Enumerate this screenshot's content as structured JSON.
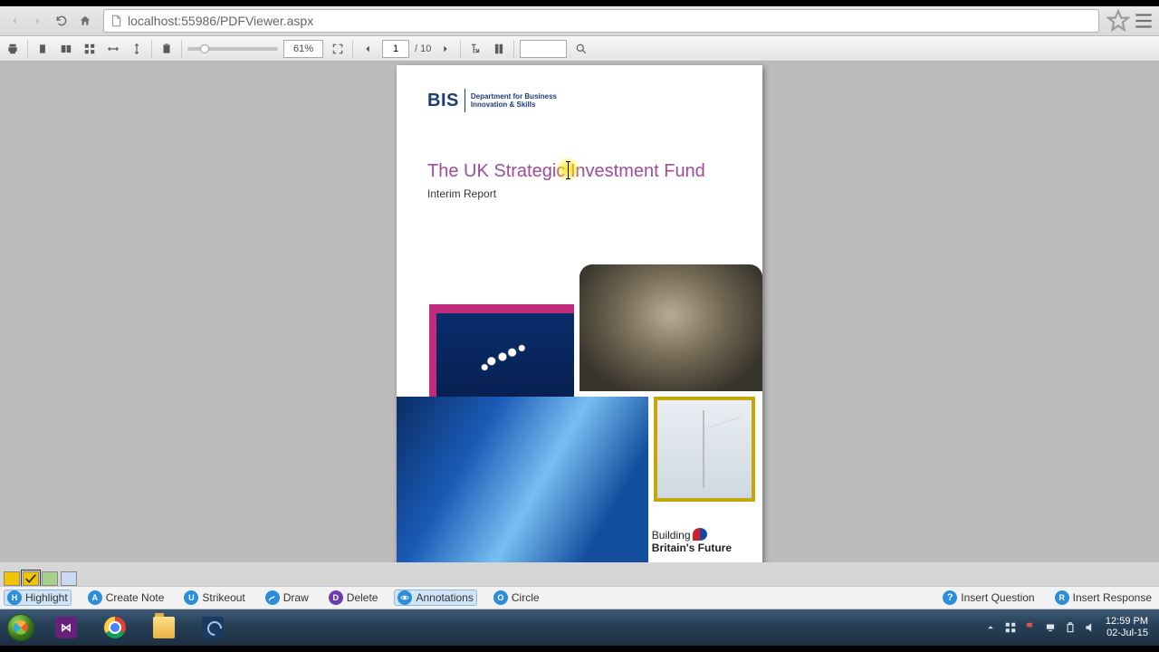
{
  "browser": {
    "url": "localhost:55986/PDFViewer.aspx"
  },
  "pdf_toolbar": {
    "zoom_percent": "61%",
    "current_page": "1",
    "total_pages_label": "/ 10"
  },
  "document": {
    "logo_abbrev": "BIS",
    "logo_line1": "Department for Business",
    "logo_line2": "Innovation & Skills",
    "title": "The UK Strategic Investment Fund",
    "subtitle": "Interim Report",
    "footer_l1": "Building",
    "footer_l2": "Britain's Future"
  },
  "palette": {
    "colors": [
      "#f2c300",
      "#f2c300",
      "#a8d08d",
      "#c9daf0"
    ],
    "active_index": 1
  },
  "annotation_bar": {
    "items": [
      {
        "key": "H",
        "label": "Highlight",
        "color": "#2c8edb",
        "active": true
      },
      {
        "key": "A",
        "label": "Create Note",
        "color": "#2c8edb",
        "active": false
      },
      {
        "key": "U",
        "label": "Strikeout",
        "color": "#2c8edb",
        "active": false
      },
      {
        "key": "",
        "label": "Draw",
        "color": "#2c8edb",
        "active": false
      },
      {
        "key": "D",
        "label": "Delete",
        "color": "#6a3db3",
        "active": false
      },
      {
        "key": "",
        "label": "Annotations",
        "color": "#2c8edb",
        "active": true
      },
      {
        "key": "O",
        "label": "Circle",
        "color": "#2c8edb",
        "active": false
      }
    ],
    "right_items": [
      {
        "label": "Insert Question"
      },
      {
        "label": "Insert Response"
      }
    ]
  },
  "taskbar": {
    "time": "12:59 PM",
    "date": "02-Jul-15"
  }
}
